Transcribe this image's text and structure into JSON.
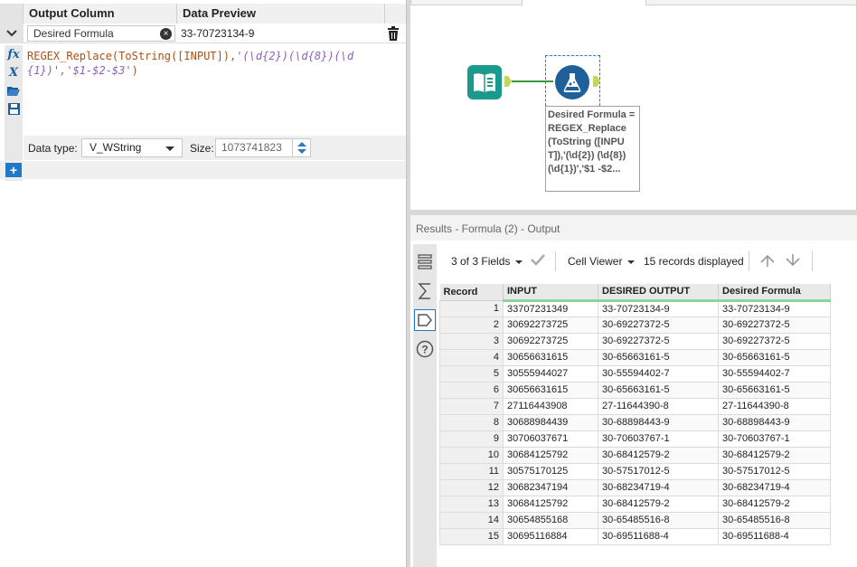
{
  "formula_panel": {
    "headers": {
      "output_column": "Output Column",
      "data_preview": "Data Preview"
    },
    "field": {
      "name": "Desired Formula",
      "preview": "33-70723134-9"
    },
    "expression": {
      "part1": "REGEX_Replace(ToString([INPUT]),",
      "part2": "'(\\d{2})(\\d{8})(\\d{1})','$1-$2-$3'",
      "part3": ")"
    },
    "data_type_label": "Data type:",
    "data_type_value": "V_WString",
    "size_label": "Size:",
    "size_value": "1073741823",
    "tool_icons": [
      "fx-icon",
      "variable-icon",
      "open-icon",
      "save-icon"
    ]
  },
  "canvas": {
    "annotation": "Desired Formula = REGEX_Replace (ToString ([INPUT]),'(\\d{2}) (\\d{8})(\\d{1})','$1 -$2..."
  },
  "results": {
    "title": "Results - Formula (2) - Output",
    "fields_selector": "3 of 3 Fields",
    "viewer_selector": "Cell Viewer",
    "records_displayed": "15 records displayed",
    "columns": [
      "Record",
      "INPUT",
      "DESIRED OUTPUT",
      "Desired Formula"
    ],
    "rows": [
      [
        "1",
        "33707231349",
        "33-70723134-9",
        "33-70723134-9"
      ],
      [
        "2",
        "30692273725",
        "30-69227372-5",
        "30-69227372-5"
      ],
      [
        "3",
        "30692273725",
        "30-69227372-5",
        "30-69227372-5"
      ],
      [
        "4",
        "30656631615",
        "30-65663161-5",
        "30-65663161-5"
      ],
      [
        "5",
        "30555944027",
        "30-55594402-7",
        "30-55594402-7"
      ],
      [
        "6",
        "30656631615",
        "30-65663161-5",
        "30-65663161-5"
      ],
      [
        "7",
        "27116443908",
        "27-11644390-8",
        "27-11644390-8"
      ],
      [
        "8",
        "30688984439",
        "30-68898443-9",
        "30-68898443-9"
      ],
      [
        "9",
        "30706037671",
        "30-70603767-1",
        "30-70603767-1"
      ],
      [
        "10",
        "30684125792",
        "30-68412579-2",
        "30-68412579-2"
      ],
      [
        "11",
        "30575170125",
        "30-57517012-5",
        "30-57517012-5"
      ],
      [
        "12",
        "30682347194",
        "30-68234719-4",
        "30-68234719-4"
      ],
      [
        "13",
        "30684125792",
        "30-68412579-2",
        "30-68412579-2"
      ],
      [
        "14",
        "30654855168",
        "30-65485516-8",
        "30-65485516-8"
      ],
      [
        "15",
        "30695116884",
        "30-69511688-4",
        "30-69511688-4"
      ]
    ]
  },
  "colors": {
    "accent": "#1f78c8",
    "input_tool": "#1a9a8c",
    "formula_tool": "#1f5f9a",
    "header_underline": "#8ad4a0"
  }
}
